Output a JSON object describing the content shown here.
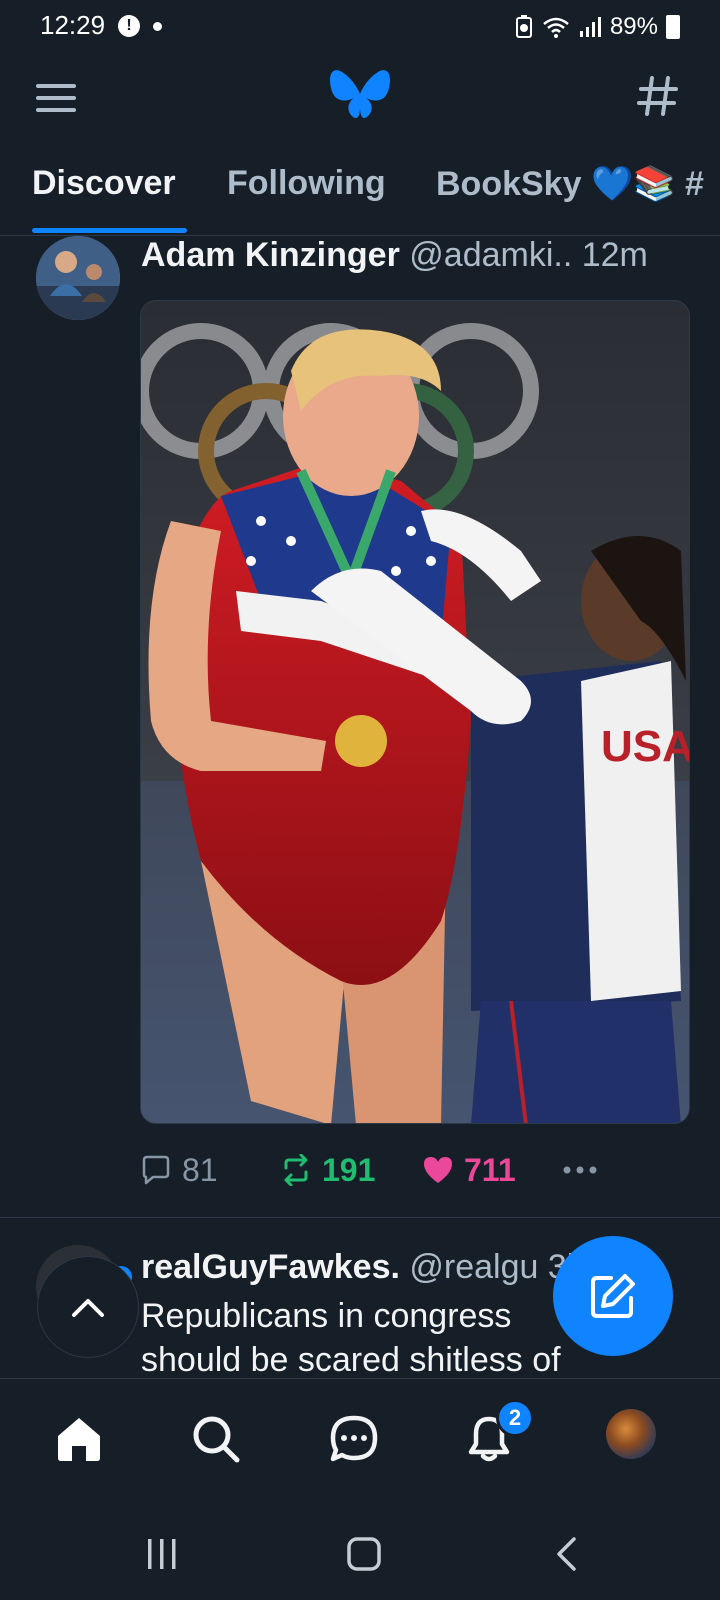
{
  "status_bar": {
    "time": "12:29",
    "battery": "89%"
  },
  "app_bar": {
    "menu_icon": "hamburger-menu-icon",
    "logo_icon": "butterfly-logo-icon",
    "feeds_icon": "hashtag-icon"
  },
  "tabs": [
    {
      "label": "Discover",
      "active": true
    },
    {
      "label": "Following",
      "active": false
    },
    {
      "label": "BookSky 💙📚 #",
      "active": false
    }
  ],
  "post": {
    "author_name": "Adam Kinzinger",
    "handle": "@adamki..",
    "time": "12m",
    "image_description_icon": "photo-image",
    "replies": "81",
    "reposts": "191",
    "likes": "711",
    "liked": true,
    "reposted": true
  },
  "post2": {
    "author_name": "realGuyFawkes.",
    "handle": "@realgu",
    "time": "3h",
    "text_line1": "Republicans in congress",
    "text_line2": "should be scared shitless of"
  },
  "bottom_nav": {
    "notification_count": "2"
  },
  "colors": {
    "background": "#161e27",
    "accent": "#1083fe",
    "repost_green": "#20bc6f",
    "like_pink": "#ec4899",
    "muted": "#aebbc9"
  }
}
